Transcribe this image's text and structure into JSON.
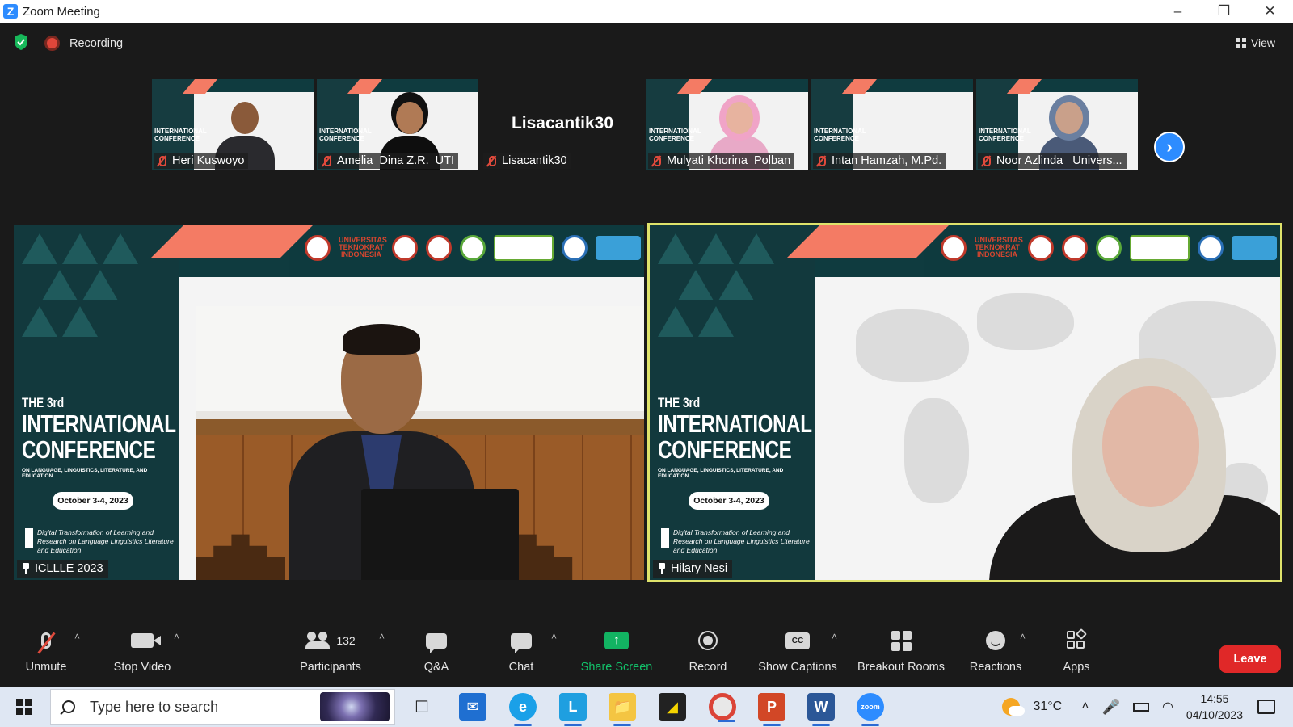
{
  "window": {
    "title": "Zoom Meeting",
    "controls": [
      "minimize",
      "restore",
      "close"
    ]
  },
  "topbar": {
    "recording_label": "Recording",
    "view_label": "View"
  },
  "thumbnails": [
    {
      "name": "Heri Kuswoyo",
      "muted": true,
      "video": true
    },
    {
      "name": "Amelia_Dina Z.R._UTI",
      "muted": true,
      "video": true
    },
    {
      "name": "Lisacantik30",
      "display_name": "Lisacantik30",
      "muted": true,
      "video": false
    },
    {
      "name": "Mulyati Khorina_Polban",
      "muted": true,
      "video": true
    },
    {
      "name": "Intan Hamzah, M.Pd.",
      "muted": true,
      "video": true
    },
    {
      "name": "Noor Azlinda _Univers...",
      "muted": true,
      "video": true
    }
  ],
  "slide": {
    "the": "THE 3rd",
    "line1": "INTERNATIONAL",
    "line2": "CONFERENCE",
    "subtitle": "ON LANGUAGE, LINGUISTICS, LITERATURE, AND EDUCATION",
    "date": "October 3-4, 2023",
    "tagline": "Digital Transformation of Learning and Research on Language Linguistics Literature and Education",
    "logo_text": "UNIVERSITAS TEKNOKRAT INDONESIA"
  },
  "main_tiles": [
    {
      "name": "ICLLLE 2023",
      "active": false
    },
    {
      "name": "Hilary Nesi",
      "active": true
    }
  ],
  "toolbar": {
    "unmute": "Unmute",
    "stop_video": "Stop Video",
    "participants": "Participants",
    "participants_count": "132",
    "qa": "Q&A",
    "chat": "Chat",
    "share_screen": "Share Screen",
    "record": "Record",
    "show_captions": "Show Captions",
    "captions_icon": "CC",
    "breakout_rooms": "Breakout Rooms",
    "reactions": "Reactions",
    "apps": "Apps",
    "leave": "Leave"
  },
  "taskbar": {
    "search_placeholder": "Type here to search",
    "temperature": "31°C",
    "time": "14:55",
    "date": "04/10/2023",
    "apps": [
      "task-view",
      "mail",
      "edge",
      "l-app",
      "file-explorer",
      "sticky-notes",
      "chrome",
      "powerpoint",
      "word",
      "zoom"
    ]
  },
  "colors": {
    "zoom_blue": "#2d8cff",
    "share_green": "#12b362",
    "leave_red": "#e02828",
    "active_speaker": "#dfe36b",
    "slide_teal": "#0f3b3f",
    "slide_salmon": "#f47b64"
  }
}
